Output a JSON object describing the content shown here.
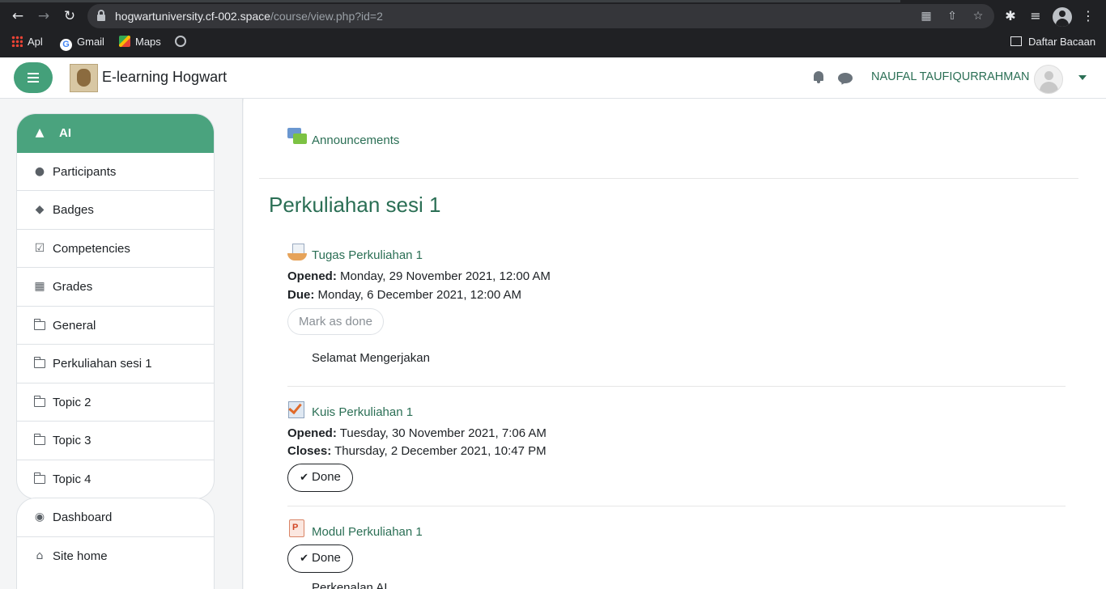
{
  "browser": {
    "url_host": "hogwartuniversity.cf-002.space",
    "url_path": "/course/view.php?id=2",
    "bookmarks": [
      {
        "label": "Apl",
        "icon": "apps-grid-icon"
      },
      {
        "label": "Gmail",
        "icon": "google-icon"
      },
      {
        "label": "Maps",
        "icon": "maps-icon"
      }
    ],
    "reading_list": "Daftar Bacaan"
  },
  "navbar": {
    "site_name": "E-learning Hogwart",
    "username": "NAUFAL TAUFIQURRAHMAN"
  },
  "drawer": {
    "items": [
      {
        "label": "AI",
        "icon": "graduation-cap-icon",
        "active": true
      },
      {
        "label": "Participants",
        "icon": "users-icon"
      },
      {
        "label": "Badges",
        "icon": "shield-icon"
      },
      {
        "label": "Competencies",
        "icon": "check-square-icon"
      },
      {
        "label": "Grades",
        "icon": "table-icon"
      },
      {
        "label": "General",
        "icon": "folder-icon"
      },
      {
        "label": "Perkuliahan sesi 1",
        "icon": "folder-icon"
      },
      {
        "label": "Topic 2",
        "icon": "folder-icon"
      },
      {
        "label": "Topic 3",
        "icon": "folder-icon"
      },
      {
        "label": "Topic 4",
        "icon": "folder-icon"
      }
    ],
    "items2": [
      {
        "label": "Dashboard",
        "icon": "dashboard-icon"
      },
      {
        "label": "Site home",
        "icon": "home-icon"
      }
    ]
  },
  "main": {
    "announcements": "Announcements",
    "section_title": "Perkuliahan sesi 1",
    "assignment": {
      "title": "Tugas Perkuliahan 1",
      "opened_label": "Opened:",
      "opened_value": "Monday, 29 November 2021, 12:00 AM",
      "due_label": "Due:",
      "due_value": "Monday, 6 December 2021, 12:00 AM",
      "mark_button": "Mark as done",
      "description": "Selamat Mengerjakan"
    },
    "quiz": {
      "title": "Kuis Perkuliahan 1",
      "opened_label": "Opened:",
      "opened_value": "Tuesday, 30 November 2021, 7:06 AM",
      "closes_label": "Closes:",
      "closes_value": "Thursday, 2 December 2021, 10:47 PM",
      "done_button": "Done"
    },
    "module": {
      "title": "Modul Perkuliahan 1",
      "done_button": "Done",
      "description": "Perkenalan AI"
    }
  }
}
